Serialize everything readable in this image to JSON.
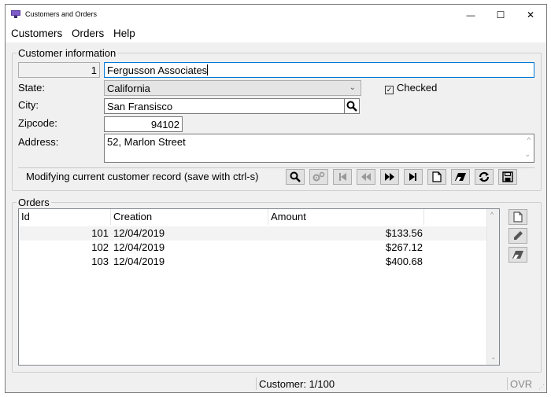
{
  "window": {
    "title": "Customers and Orders",
    "minimize_glyph": "—",
    "maximize_glyph": "☐",
    "close_glyph": "✕"
  },
  "menu": [
    "Customers",
    "Orders",
    "Help"
  ],
  "customer_info": {
    "group_label": "Customer information",
    "id_value": "1",
    "name_value": "Fergusson Associates",
    "state_label": "State:",
    "state_value": "California",
    "checked_label": "Checked",
    "checked": true,
    "city_label": "City:",
    "city_value": "San Fransisco",
    "zip_label": "Zipcode:",
    "zip_value": "94102",
    "address_label": "Address:",
    "address_value": "52, Marlon Street",
    "status_message": "Modifying current customer record (save with ctrl-s)"
  },
  "toolbar_icons": [
    "search-icon",
    "filter-settings-icon",
    "first-record-icon",
    "previous-record-icon",
    "next-record-icon",
    "last-record-icon",
    "new-record-icon",
    "clear-icon",
    "refresh-icon",
    "save-icon"
  ],
  "orders": {
    "group_label": "Orders",
    "columns": [
      "Id",
      "Creation",
      "Amount"
    ],
    "rows": [
      {
        "id": "101",
        "creation": "12/04/2019",
        "amount": "$133.56"
      },
      {
        "id": "102",
        "creation": "12/04/2019",
        "amount": "$267.12"
      },
      {
        "id": "103",
        "creation": "12/04/2019",
        "amount": "$400.68"
      }
    ]
  },
  "statusbar": {
    "record_position": "Customer: 1/100",
    "mode": "OVR"
  },
  "colors": {
    "accent": "#0078d7",
    "window_bg": "#f0f0f0",
    "selected_row": "#f3f3f3"
  }
}
